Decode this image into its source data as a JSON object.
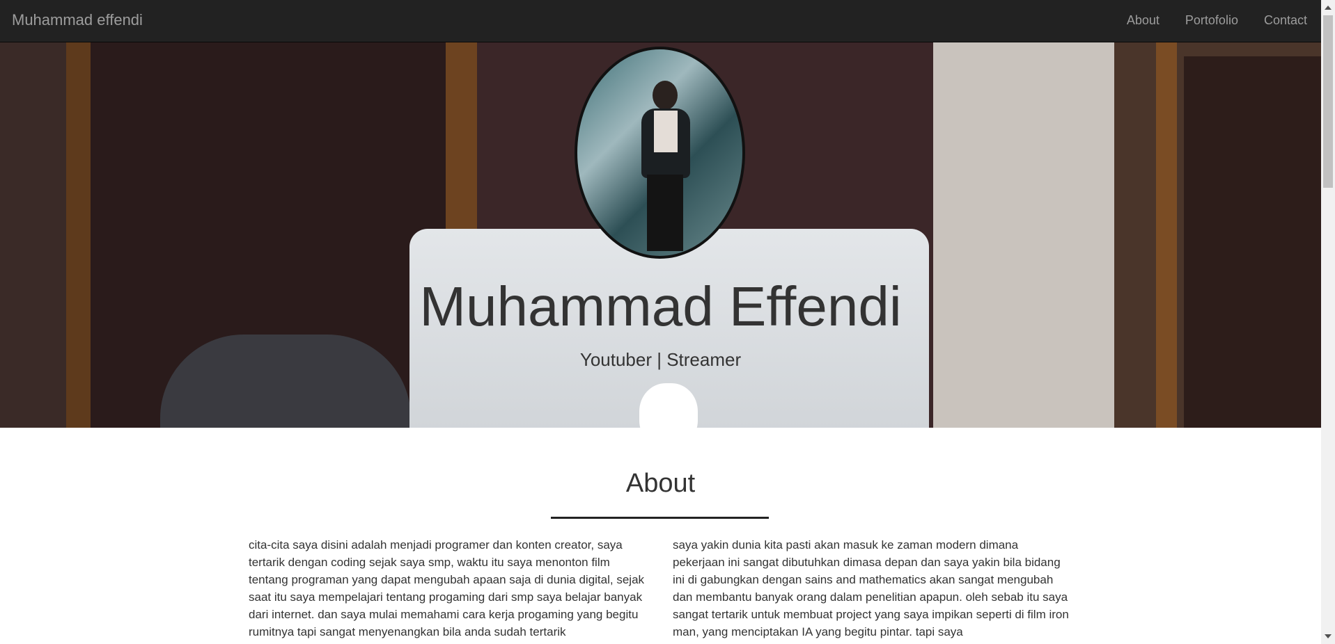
{
  "navbar": {
    "brand": "Muhammad effendi",
    "links": [
      "About",
      "Portofolio",
      "Contact"
    ]
  },
  "hero": {
    "title": "Muhammad Effendi",
    "subtitle": "Youtuber | Streamer"
  },
  "about": {
    "title": "About",
    "left_text": "cita-cita saya disini adalah menjadi programer dan konten creator, saya tertarik dengan coding sejak saya smp, waktu itu saya menonton film tentang programan yang dapat mengubah apaan saja di dunia digital, sejak saat itu saya mempelajari tentang progaming dari smp saya belajar banyak dari internet. dan saya mulai memahami cara kerja progaming yang begitu rumitnya tapi sangat menyenangkan bila anda sudah tertarik",
    "right_text": "saya yakin dunia kita pasti akan masuk ke zaman modern dimana pekerjaan ini sangat dibutuhkan dimasa depan dan saya yakin bila bidang ini di gabungkan dengan sains and mathematics akan sangat mengubah dan membantu banyak orang dalam penelitian apapun. oleh sebab itu saya sangat tertarik untuk membuat project yang saya impikan seperti di film iron man, yang menciptakan IA yang begitu pintar. tapi saya"
  },
  "colors": {
    "navbar_bg": "#222222",
    "nav_text": "#9d9d9d",
    "text": "#333333"
  }
}
